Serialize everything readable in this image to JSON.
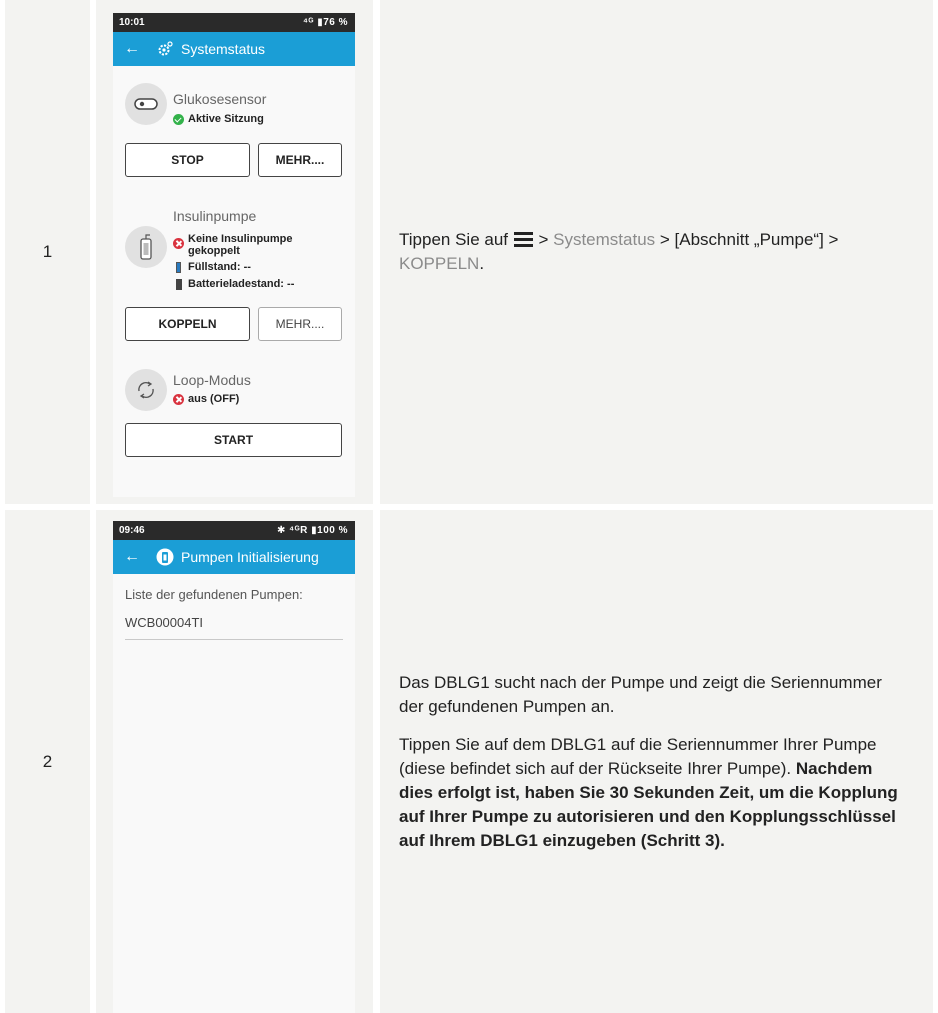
{
  "steps": [
    {
      "number": "1",
      "phone": {
        "status_time": "10:01",
        "status_right": "⁴ᴳ ▮76 %",
        "title": "Systemstatus",
        "sensor": {
          "title": "Glukosesensor",
          "status": "Aktive Sitzung",
          "btn_left": "STOP",
          "btn_right": "MEHR...."
        },
        "pump": {
          "title": "Insulinpumpe",
          "status_line1": "Keine Insulinpumpe",
          "status_line2": "gekoppelt",
          "fill": "Füllstand: --",
          "battery": "Batterieladestand: --",
          "btn_left": "KOPPELN",
          "btn_right": "MEHR...."
        },
        "loop": {
          "title": "Loop-Modus",
          "status": "aus (OFF)",
          "btn": "START"
        }
      },
      "instruction": {
        "prefix": "Tippen Sie auf ",
        "sep1": " > ",
        "link1": "Systemstatus",
        "sep2": " > [Abschnitt „Pumpe“] > ",
        "link2": "KOPPELN",
        "suffix": "."
      }
    },
    {
      "number": "2",
      "phone": {
        "status_time": "09:46",
        "status_right": "✱ ⁴ᴳR ▮100 %",
        "title": "Pumpen Initialisierung",
        "list_label": "Liste der gefundenen Pumpen:",
        "list_item": "WCB00004TI"
      },
      "instruction": {
        "para1": "Das DBLG1 sucht nach der Pumpe und zeigt die Seriennummer der gefundenen Pumpen an.",
        "para2_normal": "Tippen Sie auf dem DBLG1 auf die Seriennummer Ihrer Pumpe (diese befindet sich auf der Rückseite Ihrer Pumpe). ",
        "para2_bold": "Nachdem dies erfolgt ist, haben Sie 30 Sekunden Zeit, um die Kopplung auf Ihrer Pumpe zu autorisieren und den Kopplungsschlüssel auf Ihrem DBLG1 einzugeben (Schritt 3)."
      }
    }
  ]
}
